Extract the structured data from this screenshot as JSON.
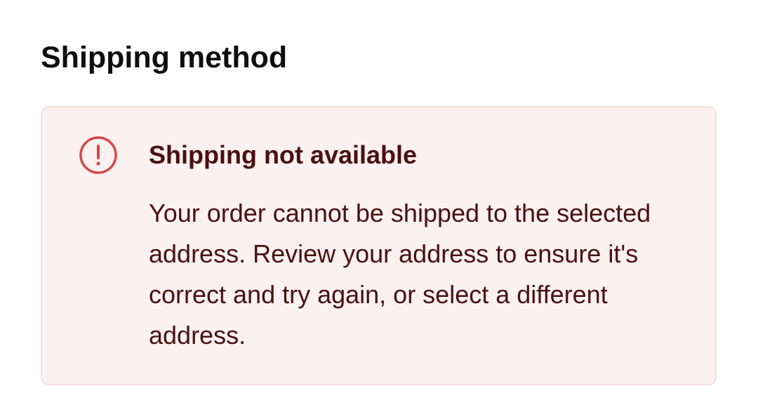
{
  "section": {
    "title": "Shipping method"
  },
  "alert": {
    "icon": "exclamation-circle-icon",
    "icon_color": "#d64545",
    "background": "#fcf1f1",
    "border": "#f6dede",
    "text_color": "#4a1010",
    "title": "Shipping not available",
    "message": "Your order cannot be shipped to the selected address. Review your address to ensure it's correct and try again, or select a different address."
  }
}
